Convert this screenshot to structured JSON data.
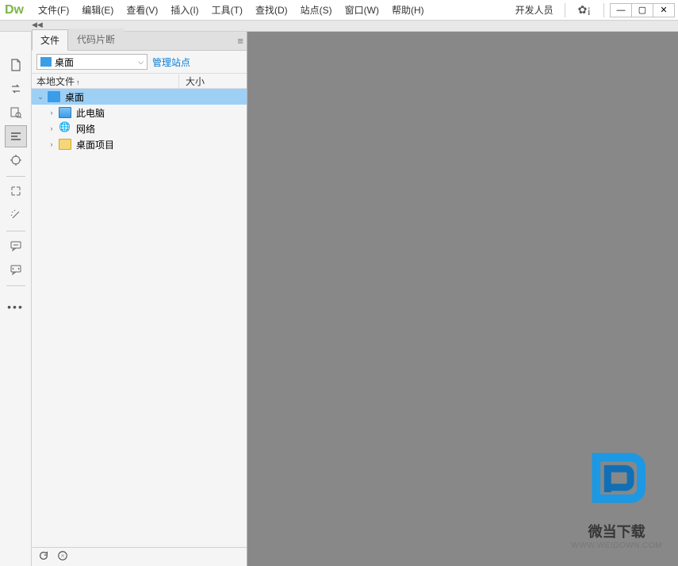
{
  "app": {
    "logo": "Dw"
  },
  "menubar": {
    "items": [
      "文件(F)",
      "编辑(E)",
      "查看(V)",
      "插入(I)",
      "工具(T)",
      "查找(D)",
      "站点(S)",
      "窗口(W)",
      "帮助(H)"
    ],
    "workspace": "开发人员"
  },
  "panel": {
    "tabs": [
      {
        "label": "文件",
        "active": true
      },
      {
        "label": "代码片断",
        "active": false
      }
    ],
    "dropdown": {
      "selected": "桌面"
    },
    "manage_link": "管理站点",
    "header": {
      "col1": "本地文件",
      "col2": "大小"
    },
    "tree": [
      {
        "label": "桌面",
        "expanded": true,
        "selected": true,
        "icon": "desktop",
        "indent": 0
      },
      {
        "label": "此电脑",
        "expanded": false,
        "selected": false,
        "icon": "computer",
        "indent": 1
      },
      {
        "label": "网络",
        "expanded": false,
        "selected": false,
        "icon": "network",
        "indent": 1
      },
      {
        "label": "桌面项目",
        "expanded": false,
        "selected": false,
        "icon": "folder",
        "indent": 1
      }
    ]
  },
  "watermark": {
    "text": "微当下载",
    "url": "WWW.WEIDOWN.COM"
  }
}
